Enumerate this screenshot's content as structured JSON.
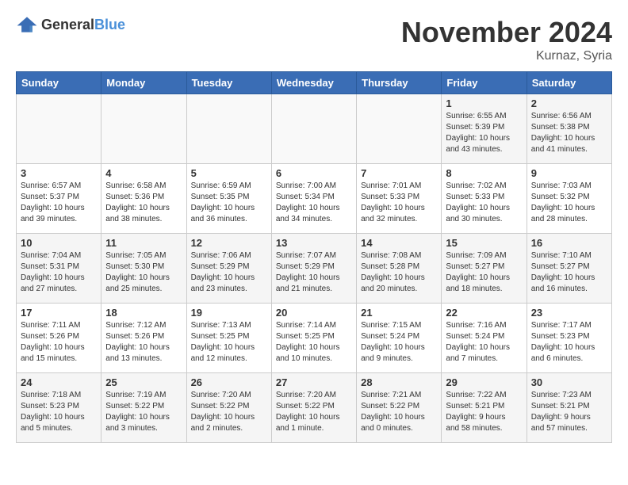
{
  "header": {
    "logo_general": "General",
    "logo_blue": "Blue",
    "month_title": "November 2024",
    "location": "Kurnaz, Syria"
  },
  "days_of_week": [
    "Sunday",
    "Monday",
    "Tuesday",
    "Wednesday",
    "Thursday",
    "Friday",
    "Saturday"
  ],
  "weeks": [
    {
      "cells": [
        {
          "day": "",
          "info": ""
        },
        {
          "day": "",
          "info": ""
        },
        {
          "day": "",
          "info": ""
        },
        {
          "day": "",
          "info": ""
        },
        {
          "day": "",
          "info": ""
        },
        {
          "day": "1",
          "info": "Sunrise: 6:55 AM\nSunset: 5:39 PM\nDaylight: 10 hours\nand 43 minutes."
        },
        {
          "day": "2",
          "info": "Sunrise: 6:56 AM\nSunset: 5:38 PM\nDaylight: 10 hours\nand 41 minutes."
        }
      ]
    },
    {
      "cells": [
        {
          "day": "3",
          "info": "Sunrise: 6:57 AM\nSunset: 5:37 PM\nDaylight: 10 hours\nand 39 minutes."
        },
        {
          "day": "4",
          "info": "Sunrise: 6:58 AM\nSunset: 5:36 PM\nDaylight: 10 hours\nand 38 minutes."
        },
        {
          "day": "5",
          "info": "Sunrise: 6:59 AM\nSunset: 5:35 PM\nDaylight: 10 hours\nand 36 minutes."
        },
        {
          "day": "6",
          "info": "Sunrise: 7:00 AM\nSunset: 5:34 PM\nDaylight: 10 hours\nand 34 minutes."
        },
        {
          "day": "7",
          "info": "Sunrise: 7:01 AM\nSunset: 5:33 PM\nDaylight: 10 hours\nand 32 minutes."
        },
        {
          "day": "8",
          "info": "Sunrise: 7:02 AM\nSunset: 5:33 PM\nDaylight: 10 hours\nand 30 minutes."
        },
        {
          "day": "9",
          "info": "Sunrise: 7:03 AM\nSunset: 5:32 PM\nDaylight: 10 hours\nand 28 minutes."
        }
      ]
    },
    {
      "cells": [
        {
          "day": "10",
          "info": "Sunrise: 7:04 AM\nSunset: 5:31 PM\nDaylight: 10 hours\nand 27 minutes."
        },
        {
          "day": "11",
          "info": "Sunrise: 7:05 AM\nSunset: 5:30 PM\nDaylight: 10 hours\nand 25 minutes."
        },
        {
          "day": "12",
          "info": "Sunrise: 7:06 AM\nSunset: 5:29 PM\nDaylight: 10 hours\nand 23 minutes."
        },
        {
          "day": "13",
          "info": "Sunrise: 7:07 AM\nSunset: 5:29 PM\nDaylight: 10 hours\nand 21 minutes."
        },
        {
          "day": "14",
          "info": "Sunrise: 7:08 AM\nSunset: 5:28 PM\nDaylight: 10 hours\nand 20 minutes."
        },
        {
          "day": "15",
          "info": "Sunrise: 7:09 AM\nSunset: 5:27 PM\nDaylight: 10 hours\nand 18 minutes."
        },
        {
          "day": "16",
          "info": "Sunrise: 7:10 AM\nSunset: 5:27 PM\nDaylight: 10 hours\nand 16 minutes."
        }
      ]
    },
    {
      "cells": [
        {
          "day": "17",
          "info": "Sunrise: 7:11 AM\nSunset: 5:26 PM\nDaylight: 10 hours\nand 15 minutes."
        },
        {
          "day": "18",
          "info": "Sunrise: 7:12 AM\nSunset: 5:26 PM\nDaylight: 10 hours\nand 13 minutes."
        },
        {
          "day": "19",
          "info": "Sunrise: 7:13 AM\nSunset: 5:25 PM\nDaylight: 10 hours\nand 12 minutes."
        },
        {
          "day": "20",
          "info": "Sunrise: 7:14 AM\nSunset: 5:25 PM\nDaylight: 10 hours\nand 10 minutes."
        },
        {
          "day": "21",
          "info": "Sunrise: 7:15 AM\nSunset: 5:24 PM\nDaylight: 10 hours\nand 9 minutes."
        },
        {
          "day": "22",
          "info": "Sunrise: 7:16 AM\nSunset: 5:24 PM\nDaylight: 10 hours\nand 7 minutes."
        },
        {
          "day": "23",
          "info": "Sunrise: 7:17 AM\nSunset: 5:23 PM\nDaylight: 10 hours\nand 6 minutes."
        }
      ]
    },
    {
      "cells": [
        {
          "day": "24",
          "info": "Sunrise: 7:18 AM\nSunset: 5:23 PM\nDaylight: 10 hours\nand 5 minutes."
        },
        {
          "day": "25",
          "info": "Sunrise: 7:19 AM\nSunset: 5:22 PM\nDaylight: 10 hours\nand 3 minutes."
        },
        {
          "day": "26",
          "info": "Sunrise: 7:20 AM\nSunset: 5:22 PM\nDaylight: 10 hours\nand 2 minutes."
        },
        {
          "day": "27",
          "info": "Sunrise: 7:20 AM\nSunset: 5:22 PM\nDaylight: 10 hours\nand 1 minute."
        },
        {
          "day": "28",
          "info": "Sunrise: 7:21 AM\nSunset: 5:22 PM\nDaylight: 10 hours\nand 0 minutes."
        },
        {
          "day": "29",
          "info": "Sunrise: 7:22 AM\nSunset: 5:21 PM\nDaylight: 9 hours\nand 58 minutes."
        },
        {
          "day": "30",
          "info": "Sunrise: 7:23 AM\nSunset: 5:21 PM\nDaylight: 9 hours\nand 57 minutes."
        }
      ]
    }
  ]
}
